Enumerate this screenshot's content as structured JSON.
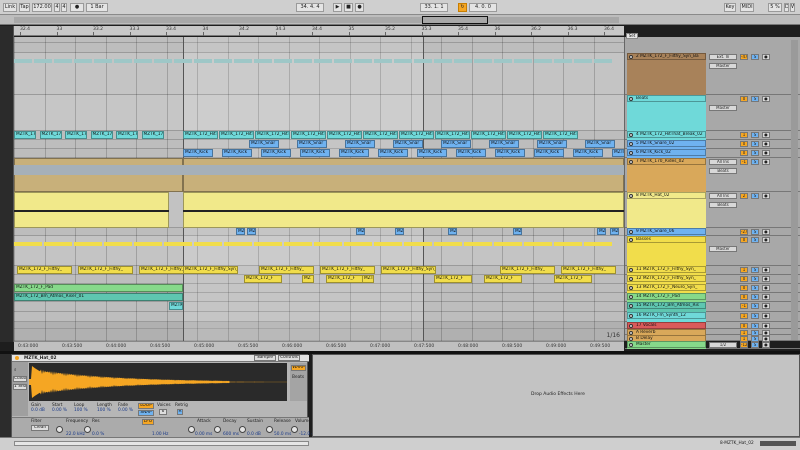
{
  "transport": {
    "link": "Link",
    "tap": "Tap",
    "tempo": "172.00",
    "sig_num": "4",
    "sig_den": "4",
    "metro": "1 Bar",
    "arr_position": "34.  4.  4",
    "loop_start": "33.  1.  1",
    "loop_length": "4.  0.  0",
    "key": "Key",
    "midi": "MIDI",
    "cpu": "5 %",
    "d_indicator": "D",
    "w_indicator": "W",
    "icons": [
      "play-icon",
      "stop-icon",
      "record-icon"
    ]
  },
  "ruler_marks": [
    {
      "label": "32.4"
    },
    {
      "label": "33"
    },
    {
      "label": "33.2"
    },
    {
      "label": "33.3"
    },
    {
      "label": "33.4"
    },
    {
      "label": "34"
    },
    {
      "label": "34.2"
    },
    {
      "label": "34.3"
    },
    {
      "label": "34.4"
    },
    {
      "label": "35"
    },
    {
      "label": "35.2"
    },
    {
      "label": "35.3"
    },
    {
      "label": "35.4"
    },
    {
      "label": "36"
    },
    {
      "label": "36.2"
    },
    {
      "label": "36.3"
    },
    {
      "label": "36.4"
    }
  ],
  "time_labels": [
    "0:43:000",
    "0:43:500",
    "0:44:000",
    "0:44:500",
    "0:45:000",
    "0:45:500",
    "0:46:000",
    "0:46:500",
    "0:47:000",
    "0:47:500",
    "0:48:000",
    "0:48:500",
    "0:49:000",
    "0:49:500"
  ],
  "zoom_indicator": "1/16",
  "set_button": "Set",
  "clips": {
    "hithat": "MZTK_172_HitThat",
    "hithat_short": "MZTK_172_Hi",
    "snare": "MZTK_Snare",
    "snare_short": "MZTK_Snar",
    "kick": "MZTK_Kick_",
    "kick_short": "MZTK_Kick",
    "mz": "MZ",
    "filthy": "MZTK_172_F_Filthy_",
    "filthy_syn": "MZTK_172_F_Filthy_Syn_Ba",
    "filthy_short": "MZTK_172_F",
    "filthy_cut": "MZTK_172_F_Filthy_Sy",
    "fhat": "MZTK_172_F_Pad",
    "atmos": "MZTK_172_Bm_Atmos_Riser_01",
    "mztk": "MZTK"
  },
  "tracks": [
    {
      "num": "2",
      "name": "2 MZTK_172_F_Filthy_Syn_Ba",
      "color": "#a8825a",
      "vol": "-4.0",
      "in": "Ext. In",
      "mon": "Master"
    },
    {
      "num": "",
      "name": "Beats",
      "color": "#6fd9d9",
      "vol": "",
      "in": "",
      "mon": "Master"
    },
    {
      "num": "4",
      "name": "4 MZTK_172_HitThat_Break_02",
      "color": "#6fd9d9",
      "vol": "",
      "in": "",
      "mon": ""
    },
    {
      "num": "5",
      "name": "5 MZTK_Snare_02",
      "color": "#6fb2f0",
      "vol": "",
      "in": "",
      "mon": ""
    },
    {
      "num": "6",
      "name": "6 MZTK_Kick_02",
      "color": "#6fb2f0",
      "vol": "",
      "in": "",
      "mon": ""
    },
    {
      "num": "7",
      "name": "7 MZTK_170_Rides_02",
      "color": "#d9a85a",
      "vol": "",
      "in": "All Ins",
      "mon": "Beats"
    },
    {
      "num": "8",
      "name": "8 MZTK_Hat_02",
      "color": "#f1e98a",
      "vol": "",
      "in": "All Ins",
      "mon": "Beats"
    },
    {
      "num": "9",
      "name": "9 MZTK_Snare_06",
      "color": "#6fb2f0",
      "vol": "",
      "in": "",
      "mon": ""
    },
    {
      "num": "",
      "name": "Basses",
      "color": "#f1dd4b",
      "vol": "",
      "in": "",
      "mon": "Master"
    },
    {
      "num": "11",
      "name": "11 MZTK_172_F_Filthy_Syn_",
      "color": "#f1dd4b",
      "vol": "",
      "in": "",
      "mon": ""
    },
    {
      "num": "12",
      "name": "12 MZTK_172_F_Filthy_Syn_",
      "color": "#f1dd4b",
      "vol": "",
      "in": "",
      "mon": ""
    },
    {
      "num": "13",
      "name": "13 MZTK_172_F_Neuro_Syn_",
      "color": "#f1dd4b",
      "vol": "",
      "in": "",
      "mon": ""
    },
    {
      "num": "14",
      "name": "14 MZTK_172_F_Pad",
      "color": "#86d98a",
      "vol": "",
      "in": "",
      "mon": ""
    },
    {
      "num": "15",
      "name": "15 MZTK_172_Bm_Atmos_Ris",
      "color": "#5ec6b0",
      "vol": "",
      "in": "",
      "mon": ""
    },
    {
      "num": "16",
      "name": "16 MZTK_Fm_Synth_12",
      "color": "#6fd9d9",
      "vol": "",
      "in": "",
      "mon": ""
    },
    {
      "num": "17",
      "name": "17 Vocals",
      "color": "#d95a5a",
      "vol": "",
      "in": "",
      "mon": ""
    },
    {
      "num": "A",
      "name": "A Reverb",
      "color": "#d9a85a",
      "vol": "",
      "in": "",
      "mon": ""
    },
    {
      "num": "B",
      "name": "B Delay",
      "color": "#d9a85a",
      "vol": "",
      "in": "",
      "mon": ""
    },
    {
      "num": "",
      "name": "Master",
      "color": "#86d98a",
      "vol": "-12.0",
      "in": "",
      "mon": "1/2"
    }
  ],
  "mixer_labels": {
    "ext_in": "Ext. In",
    "all_ins": "All Ins",
    "all_channels": "All Channe",
    "in": "In",
    "auto": "Auto",
    "off": "Off",
    "master": "Master",
    "beats": "Beats",
    "solo": "S",
    "cue": "C",
    "arm": "●",
    "vol_values": [
      "-4.0",
      "0",
      "1",
      "0",
      "0",
      "-1",
      "2",
      "-2.0",
      "0",
      "1",
      "0",
      "0",
      "0",
      "-1",
      "1",
      "0",
      "1",
      "1",
      "-12.0"
    ]
  },
  "clip_view": {
    "clip_name": "MZTK_Hat_02",
    "tab_sample": "Sample",
    "tab_controls": "Controls",
    "gain_label": "Gain",
    "gain_val": "0.0 dB",
    "start_label": "Start",
    "start_val": "0.00 %",
    "loop_label": "Loop",
    "loop_val": "100 %",
    "length_label": "Length",
    "length_val": "100 %",
    "fade_label": "Fade",
    "fade_val": "0.00 %",
    "loop_btn": "LOOP",
    "snap_btn": "SNAP",
    "voices_label": "Voices",
    "voices_val": "6",
    "retrig_label": "Retrig",
    "filter_label": "Filter",
    "filter_type": "Clean",
    "frequency_label": "Frequency",
    "frequency_val": "22.0 kHz",
    "res_label": "Res",
    "res_val": "0.0 %",
    "lfo_btn": "LFO",
    "lfo_val": "1.00 Hz",
    "attack_label": "Attack",
    "attack_val": "0.00 ms",
    "decay_label": "Decay",
    "decay_val": "600 ms",
    "sustain_label": "Sustain",
    "sustain_val": "0.0 dB",
    "release_label": "Release",
    "release_val": "50.0 ms",
    "volume_label": "Volume",
    "volume_val": "-12.0 dB",
    "one_shot": "1 Shot",
    "classic_btn": "Classic",
    "beats_label": "Beats",
    "trig_label": "Trig",
    "gate_label": "Gate",
    "num_one": "1",
    "num_two": "2",
    "lp_label": "Low",
    "lp24": "LP24"
  },
  "device_view": {
    "drop_text": "Drop Audio Effects Here"
  },
  "status": {
    "current": "8-MZTK_Hat_02"
  }
}
